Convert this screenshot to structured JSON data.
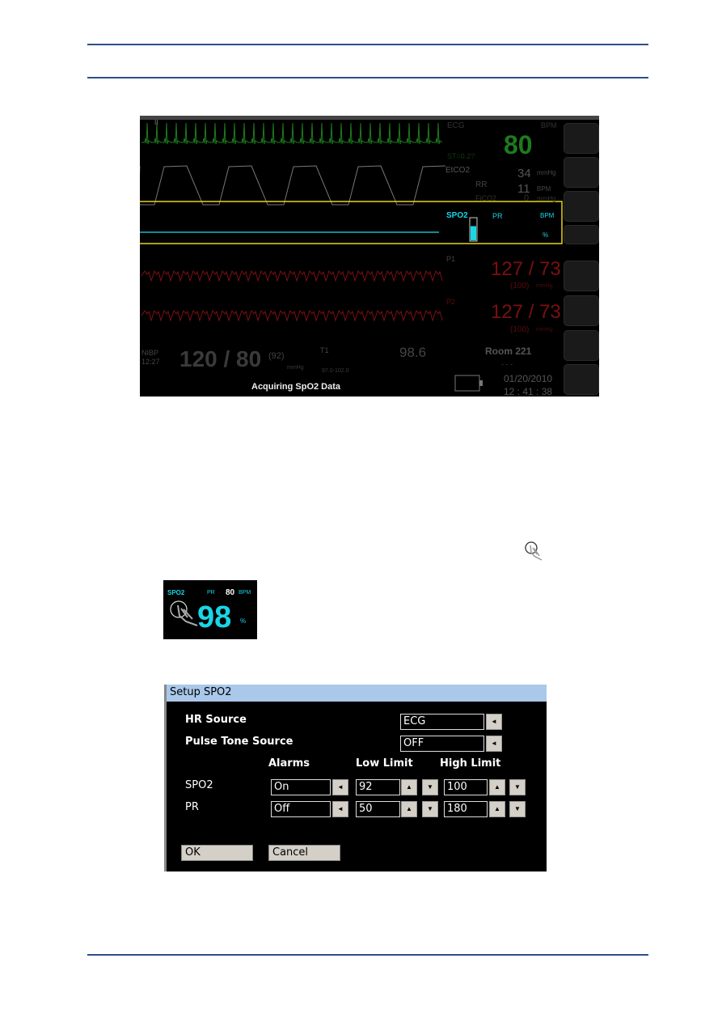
{
  "monitor": {
    "ecg": {
      "label": "ECG",
      "unit": "BPM",
      "value": "80",
      "lead": "II",
      "st": "ST=0.2?"
    },
    "etco2": {
      "label": "EtCO2",
      "value": "34",
      "unit": "mmHg",
      "rr_label": "RR",
      "rr_value": "11",
      "rr_unit": "BPM",
      "fico2_label": "FiCO2",
      "fico2_value": "0",
      "fico2_unit": "mmHg"
    },
    "spo2": {
      "label": "SPO2",
      "pr_label": "PR",
      "pr_unit": "BPM",
      "unit": "%",
      "signal_level": 0.65
    },
    "p1": {
      "label": "P1",
      "value": "127 / 73",
      "mean": "(100)",
      "unit": "mmHg"
    },
    "p2": {
      "label": "P2",
      "value": "127 / 73",
      "mean": "(100)",
      "unit": "mmHg"
    },
    "nibp": {
      "label": "NIBP",
      "time": "12:27",
      "value": "120 / 80",
      "mean": "(92)",
      "unit": "mmHg"
    },
    "temp": {
      "label": "T1",
      "value": "98.6",
      "range": "97.0-102.0"
    },
    "room": "Room 221",
    "room_sub": "- - -",
    "date": "01/20/2010",
    "time": "12 : 41 : 38",
    "status": "Acquiring SpO2 Data",
    "side_buttons": [
      "large-numeric-icon",
      "waveform-setup-icon",
      "mark-icon",
      "alarm-silence-icon",
      "standby-icon",
      "print-icon",
      "trends-icon",
      "system-icon"
    ],
    "colors": {
      "ecg": "#1e7a1e",
      "spo2": "#19d6e6",
      "pressure": "#8a0f0f",
      "highlight": "#e6d21e"
    }
  },
  "thumbnail": {
    "label": "SPO2",
    "pr_label": "PR",
    "pr_value": "80",
    "pr_unit": "BPM",
    "value": "98",
    "unit": "%"
  },
  "dialog": {
    "title": "Setup SPO2",
    "hr_source": {
      "label": "HR Source",
      "value": "ECG"
    },
    "pulse_tone": {
      "label": "Pulse Tone Source",
      "value": "OFF"
    },
    "headers": {
      "alarms": "Alarms",
      "low": "Low Limit",
      "high": "High Limit"
    },
    "rows": [
      {
        "label": "SPO2",
        "alarm": "On",
        "low": "92",
        "high": "100"
      },
      {
        "label": "PR",
        "alarm": "Off",
        "low": "50",
        "high": "180"
      }
    ],
    "ok": "OK",
    "cancel": "Cancel",
    "arrow_left": "◄",
    "arrow_up": "▲",
    "arrow_down": "▼"
  }
}
